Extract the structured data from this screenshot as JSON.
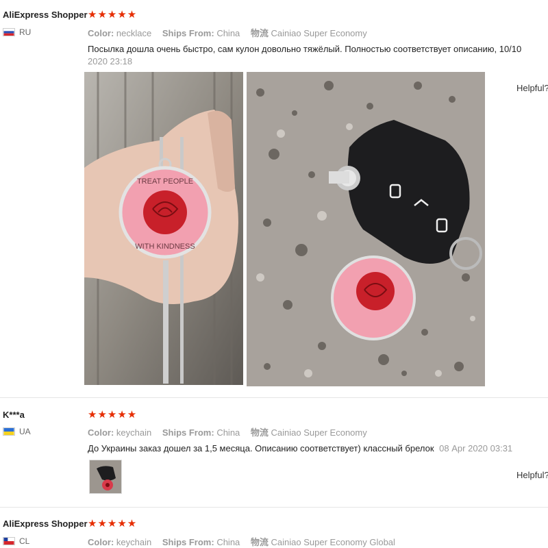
{
  "reviews": [
    {
      "name": "AliExpress Shopper",
      "stars": "★★★★★",
      "country": "RU",
      "color_label": "Color:",
      "color": "necklace",
      "ships_label": "Ships From:",
      "ships": "China",
      "logistics_label": "物流",
      "logistics": "Cainiao Super Economy",
      "text": "Посылка дошла очень быстро, сам кулон довольно тяжёлый. Полностью соответствует описанию, 10/10",
      "date": "2020 23:18",
      "helpful": "Helpful?",
      "pendant_text_1": "TREAT PEOPLE",
      "pendant_text_2": "WITH KINDNESS"
    },
    {
      "name": "K***a",
      "stars": "★★★★★",
      "country": "UA",
      "color_label": "Color:",
      "color": "keychain",
      "ships_label": "Ships From:",
      "ships": "China",
      "logistics_label": "物流",
      "logistics": "Cainiao Super Economy",
      "text": "До Украины заказ дошел за 1,5 месяца. Описанию соответствует) классный брелок",
      "date": "08 Apr 2020 03:31",
      "helpful": "Helpful?"
    },
    {
      "name": "AliExpress Shopper",
      "stars": "★★★★★",
      "country": "CL",
      "color_label": "Color:",
      "color": "keychain",
      "ships_label": "Ships From:",
      "ships": "China",
      "logistics_label": "物流",
      "logistics": "Cainiao Super Economy Global"
    }
  ],
  "colors": {
    "stars": "#e62e04",
    "meta": "#999999",
    "pendant": "#f2a0b0",
    "rose": "#c8202a"
  }
}
